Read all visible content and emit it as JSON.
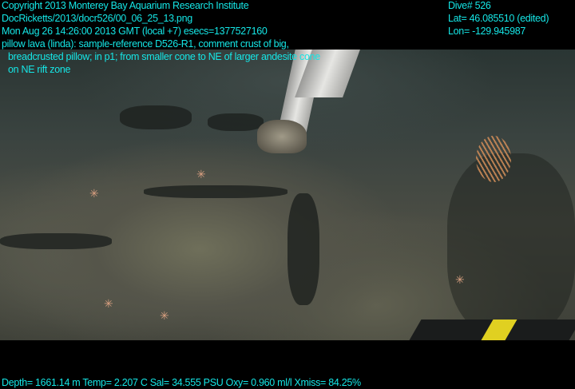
{
  "header": {
    "copyright": "Copyright 2013 Monterey Bay Aquarium Research Institute",
    "file": "DocRicketts/2013/docr526/00_06_25_13.png",
    "datetime": "Mon Aug 26 14:26:00 2013 GMT (local +7)  esecs=1377527160",
    "comment_line1": "pillow lava (linda): sample-reference D526-R1, comment crust of big,",
    "comment_line2": "breadcrusted pillow; in p1; from smaller cone to NE of larger andesite cone",
    "comment_line3": "on NE rift zone"
  },
  "nav": {
    "dive": "Dive# 526",
    "lat": "Lat= 46.085510 (edited)",
    "lon": "Lon= -129.945987"
  },
  "footer": {
    "sensors": "Depth= 1661.14 m  Temp= 2.207 C  Sal= 34.555 PSU  Oxy= 0.960 ml/l  Xmiss= 84.25%"
  }
}
